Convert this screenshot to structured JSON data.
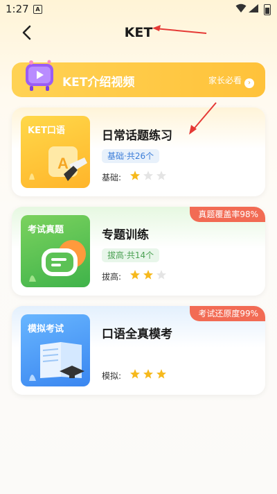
{
  "status": {
    "time": "1:27",
    "sim": "A"
  },
  "nav": {
    "title": "KET"
  },
  "banner": {
    "title": "KET介绍视频",
    "link": "家长必看"
  },
  "cards": [
    {
      "thumb_label": "KET口语",
      "title": "日常话题练习",
      "tag": "基础·共26个",
      "level_label": "基础:",
      "stars_filled": 1,
      "stars_total": 3
    },
    {
      "thumb_label": "考试真题",
      "title": "专题训练",
      "tag": "拔高·共14个",
      "level_label": "拔高:",
      "stars_filled": 2,
      "stars_total": 3,
      "badge": "真题覆盖率98%"
    },
    {
      "thumb_label": "模拟考试",
      "title": "口语全真模考",
      "level_label": "模拟:",
      "stars_filled": 3,
      "stars_total": 3,
      "badge": "考试还原度99%"
    }
  ],
  "colors": {
    "accent": "#ffc23a",
    "badge": "#f26b54",
    "star_on": "#f6b91d",
    "star_off": "#e4e4e4"
  },
  "icons": [
    "back-arrow-icon",
    "video-icon",
    "chevron-right-icon",
    "star-icon"
  ]
}
